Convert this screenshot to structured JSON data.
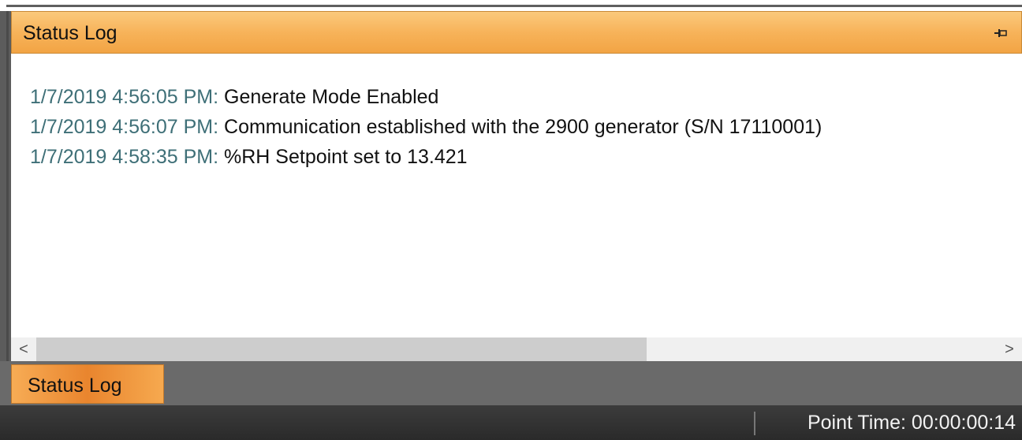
{
  "panel": {
    "title": "Status Log",
    "pin_icon": "pin-icon"
  },
  "log": {
    "entries": [
      {
        "time": "1/7/2019 4:56:05 PM:",
        "message": "Generate Mode Enabled"
      },
      {
        "time": "1/7/2019 4:56:07 PM:",
        "message": "Communication established with the 2900 generator (S/N 17110001)"
      },
      {
        "time": "1/7/2019 4:58:35 PM:",
        "message": "%RH Setpoint set to 13.421"
      }
    ]
  },
  "scrollbar": {
    "left_arrow": "<",
    "right_arrow": ">"
  },
  "tabs": [
    {
      "label": "Status Log",
      "active": true
    }
  ],
  "status_bar": {
    "point_time": "Point Time: 00:00:00:14"
  },
  "colors": {
    "accent_orange": "#f7b35a",
    "timestamp_color": "#3e6f77"
  }
}
